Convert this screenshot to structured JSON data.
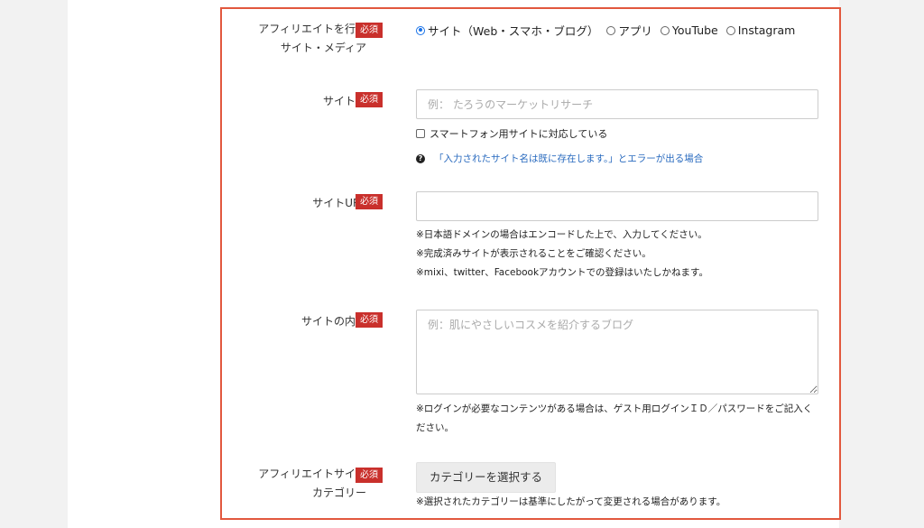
{
  "required_badge": "必須",
  "rows": {
    "media": {
      "label_line1": "アフィリエイトを行う",
      "label_line2": "サイト・メディア",
      "options": [
        {
          "label": "サイト（Web・スマホ・ブログ）",
          "checked": true
        },
        {
          "label": "アプリ",
          "checked": false
        },
        {
          "label": "YouTube",
          "checked": false
        },
        {
          "label": "Instagram",
          "checked": false
        }
      ]
    },
    "site_name": {
      "label": "サイト名",
      "placeholder": "例： たろうのマーケットリサーチ",
      "checkbox_label": "スマートフォン用サイトに対応している",
      "help_link": "「入力されたサイト名は既に存在します。」とエラーが出る場合"
    },
    "site_url": {
      "label": "サイトURL",
      "placeholder": "",
      "notes": [
        "※日本語ドメインの場合はエンコードした上で、入力してください。",
        "※完成済みサイトが表示されることをご確認ください。",
        "※mixi、twitter、Facebookアカウントでの登録はいたしかねます。"
      ]
    },
    "site_content": {
      "label": "サイトの内容",
      "placeholder": "例：肌にやさしいコスメを紹介するブログ",
      "note_line1": "※ログインが必要なコンテンツがある場合は、ゲスト用ログインＩＤ／パスワードをご記入く",
      "note_line2": "ださい。"
    },
    "category": {
      "label_line1": "アフィリエイトサイト",
      "label_line2": "カテゴリー",
      "button_label": "カテゴリーを選択する",
      "note": "※選択されたカテゴリーは基準にしたがって変更される場合があります。"
    }
  },
  "colors": {
    "accent_border": "#e2583e",
    "badge_bg": "#c9302c",
    "link": "#2a6bbf",
    "radio_checked": "#1a73e8"
  }
}
